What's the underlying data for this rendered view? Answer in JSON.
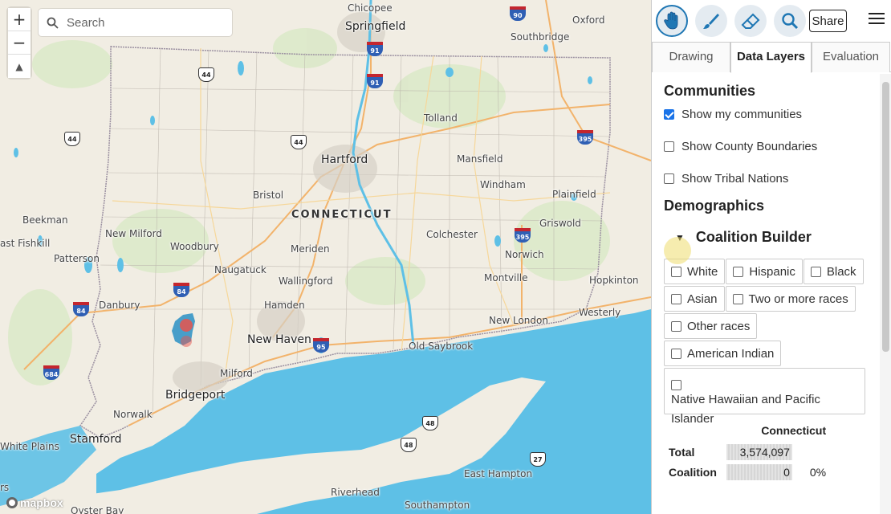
{
  "map": {
    "search_placeholder": "Search",
    "zoom_in": "+",
    "zoom_out": "−",
    "compass": "▲",
    "attribution": "mapbox",
    "state_label": "CONNECTICUT",
    "places": [
      {
        "name": "Chicopee"
      },
      {
        "name": "Springfield"
      },
      {
        "name": "Oxford"
      },
      {
        "name": "Southbridge"
      },
      {
        "name": "Tolland"
      },
      {
        "name": "Hartford"
      },
      {
        "name": "Mansfield"
      },
      {
        "name": "Bristol"
      },
      {
        "name": "Windham"
      },
      {
        "name": "Plainfield"
      },
      {
        "name": "Beekman"
      },
      {
        "name": "ast Fishkill"
      },
      {
        "name": "New Milford"
      },
      {
        "name": "Woodbury"
      },
      {
        "name": "Griswold"
      },
      {
        "name": "Patterson"
      },
      {
        "name": "Naugatuck"
      },
      {
        "name": "Meriden"
      },
      {
        "name": "Colchester"
      },
      {
        "name": "Norwich"
      },
      {
        "name": "Wallingford"
      },
      {
        "name": "Montville"
      },
      {
        "name": "Hopkinton"
      },
      {
        "name": "Danbury"
      },
      {
        "name": "Hamden"
      },
      {
        "name": "Westerly"
      },
      {
        "name": "New London"
      },
      {
        "name": "New Haven"
      },
      {
        "name": "Old Saybrook"
      },
      {
        "name": "Milford"
      },
      {
        "name": "Bridgeport"
      },
      {
        "name": "Norwalk"
      },
      {
        "name": "Stamford"
      },
      {
        "name": "White Plains"
      },
      {
        "name": "East Hampton"
      },
      {
        "name": "Riverhead"
      },
      {
        "name": "Southampton"
      },
      {
        "name": "Oyster Bay"
      },
      {
        "name": "rs"
      }
    ],
    "shields": [
      {
        "type": "interstate",
        "num": "90"
      },
      {
        "type": "interstate",
        "num": "91"
      },
      {
        "type": "interstate",
        "num": "91"
      },
      {
        "type": "us",
        "num": "44"
      },
      {
        "type": "us",
        "num": "44"
      },
      {
        "type": "us",
        "num": "44"
      },
      {
        "type": "interstate",
        "num": "395"
      },
      {
        "type": "interstate",
        "num": "395"
      },
      {
        "type": "interstate",
        "num": "84"
      },
      {
        "type": "interstate",
        "num": "84"
      },
      {
        "type": "interstate",
        "num": "684"
      },
      {
        "type": "interstate",
        "num": "95"
      },
      {
        "type": "us",
        "num": "48"
      },
      {
        "type": "us",
        "num": "48"
      },
      {
        "type": "us",
        "num": "27"
      }
    ]
  },
  "sidebar": {
    "tools": [
      "hand-icon",
      "brush-icon",
      "eraser-icon",
      "search-icon"
    ],
    "share_label": "Share",
    "tabs": [
      {
        "label": "Drawing"
      },
      {
        "label": "Data Layers"
      },
      {
        "label": "Evaluation"
      }
    ],
    "communities": {
      "title": "Communities",
      "options": [
        {
          "label": "Show my communities",
          "checked": true
        },
        {
          "label": "Show County Boundaries",
          "checked": false
        },
        {
          "label": "Show Tribal Nations",
          "checked": false
        }
      ]
    },
    "demographics": {
      "title": "Demographics",
      "coalition_title": "Coalition Builder",
      "groups": [
        {
          "label": "White"
        },
        {
          "label": "Hispanic"
        },
        {
          "label": "Black"
        },
        {
          "label": "Asian"
        },
        {
          "label": "Two or more races"
        },
        {
          "label": "Other races"
        },
        {
          "label": "American Indian"
        },
        {
          "label": "Native Hawaiian and Pacific Islander"
        }
      ],
      "table": {
        "column_header": "Connecticut",
        "rows": [
          {
            "label": "Total",
            "value": "3,574,097",
            "pct": ""
          },
          {
            "label": "Coalition",
            "value": "0",
            "pct": "0%"
          }
        ]
      }
    }
  },
  "colors": {
    "water": "#5ec0e6",
    "land": "#f1ede3",
    "accent": "#1f77b4",
    "community_fill": "#2a8fc4",
    "community_marker": "#e8544d"
  }
}
